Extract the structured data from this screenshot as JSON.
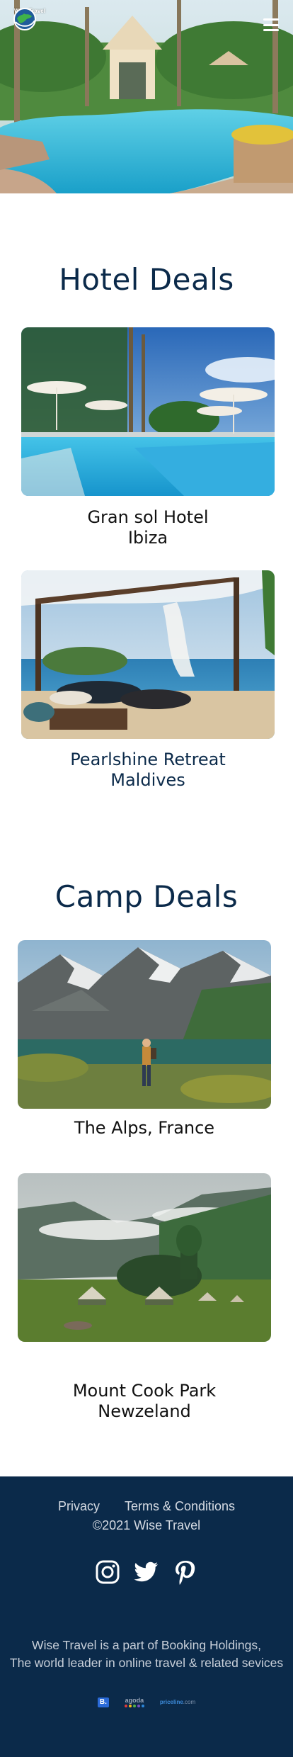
{
  "header": {
    "logo_text": "Wise Travel",
    "menu_icon": "hamburger-icon"
  },
  "hotels": {
    "title": "Hotel Deals",
    "items": [
      {
        "line1": "Gran sol Hotel",
        "line2": "Ibiza",
        "color": "#111111"
      },
      {
        "line1": "Pearlshine Retreat",
        "line2": "Maldives",
        "color": "#0b2a4a"
      }
    ]
  },
  "camps": {
    "title": "Camp Deals",
    "items": [
      {
        "line1": "The Alps, France",
        "line2": "",
        "color": "#111111"
      },
      {
        "line1": "Mount Cook Park",
        "line2": "Newzeland",
        "color": "#111111"
      }
    ]
  },
  "footer": {
    "privacy": "Privacy",
    "terms": "Terms & Conditions",
    "copyright": "©2021 Wise Travel",
    "socials": [
      "instagram-icon",
      "twitter-icon",
      "pinterest-icon"
    ],
    "about_line1": "Wise Travel is a part of Booking Holdings,",
    "about_line2": "The world leader in online travel & related sevices",
    "partners": {
      "booking": "B.",
      "agoda": "agoda",
      "priceline": "priceline",
      "priceline_suffix": ".com"
    },
    "colors": {
      "background": "#0b2a4a",
      "text": "#d6dbe3"
    }
  }
}
